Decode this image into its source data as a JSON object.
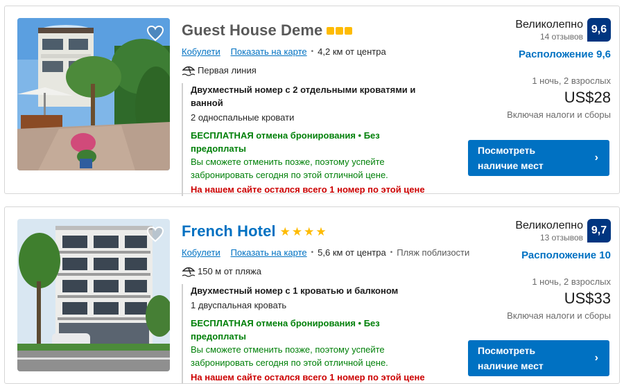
{
  "hotels": [
    {
      "name": "Guest House Deme",
      "rating_type": "squares",
      "rating": 3,
      "city": "Кобулети",
      "map_link": "Показать на карте",
      "distance": "4,2 км от центра",
      "extra_location": "",
      "feature_icon": "beach-umbrella-icon",
      "feature": "Первая линия",
      "room_title": "Двухместный номер с 2 отдельными кроватями и ванной",
      "beds": "2 односпальные кровати",
      "free_cancel": "БЕСПЛАТНАЯ отмена бронирования • Без предоплаты",
      "cancel_note": "Вы сможете отменить позже, поэтому успейте забронировать сегодня по этой отличной цене.",
      "scarcity": "На нашем сайте остался всего 1 номер по этой цене",
      "score_word": "Великолепно",
      "reviews": "14 отзывов",
      "score": "9,6",
      "location_score": "Расположение 9,6",
      "nights": "1 ночь, 2 взрослых",
      "price": "US$28",
      "taxes": "Включая налоги и сборы",
      "cta": "Посмотреть\nналичие мест"
    },
    {
      "name": "French Hotel",
      "rating_type": "stars",
      "rating": 4,
      "city": "Кобулети",
      "map_link": "Показать на карте",
      "distance": "5,6 км от центра",
      "extra_location": "Пляж поблизости",
      "feature_icon": "beach-umbrella-icon",
      "feature": "150 м от пляжа",
      "room_title": "Двухместный номер с 1 кроватью и балконом",
      "beds": "1 двуспальная кровать",
      "free_cancel": "БЕСПЛАТНАЯ отмена бронирования • Без предоплаты",
      "cancel_note": "Вы сможете отменить позже, поэтому успейте забронировать сегодня по этой отличной цене.",
      "scarcity": "На нашем сайте остался всего 1 номер по этой цене",
      "score_word": "Великолепно",
      "reviews": "13 отзывов",
      "score": "9,7",
      "location_score": "Расположение 10",
      "nights": "1 ночь, 2 взрослых",
      "price": "US$33",
      "taxes": "Включая налоги и сборы",
      "cta": "Посмотреть\nналичие мест"
    }
  ],
  "colors": {
    "brand_blue": "#0071c2",
    "badge_blue": "#003580",
    "star_yellow": "#febb02",
    "green": "#008009",
    "red": "#cc0000"
  }
}
